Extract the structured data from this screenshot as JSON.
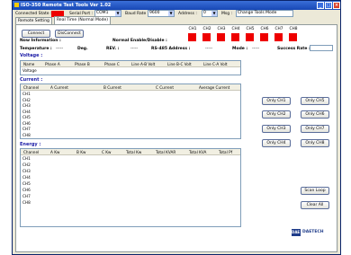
{
  "window": {
    "title": "ISO-350 Remote Test Tools Ver 1.02"
  },
  "connection": {
    "state_label": "Connected State :",
    "serial_label": "Serial Port :",
    "serial_value": "COM1",
    "baud_label": "Baud Rate :",
    "baud_value": "9600",
    "address_label": "Address :",
    "address_value": "0",
    "msg_label": "Msg :",
    "msg_value": "Change Tools Mode",
    "status_color": "#ee0000"
  },
  "tabs": [
    {
      "label": "Remote Setting"
    },
    {
      "label": "Real Time (Normal Mode)"
    }
  ],
  "controls": {
    "connect": "Connect",
    "disconnect": "DisConnect",
    "now_info": "Now Information :",
    "normal_enable": "Normal Enable/Disable :",
    "temperature": "Temperature :",
    "temp_value": "-----",
    "temp_unit": "Deg.",
    "rev_label": "REV. :",
    "rev_value": "-----",
    "rs485_label": "RS-485 Address :",
    "rs485_value": "-----",
    "mode_label": "Mode :",
    "mode_value": "-----",
    "success_label": "Success Rate :"
  },
  "channels": [
    "CH1",
    "CH2",
    "CH3",
    "CH4",
    "CH5",
    "CH6",
    "CH7",
    "CH8"
  ],
  "voltage": {
    "title": "Voltage :",
    "headers": [
      "Name",
      "Phase A",
      "Phase B",
      "Phase C",
      "Line A-B Volt",
      "Line B-C Volt",
      "Line C-A Volt"
    ],
    "row": "Voltage"
  },
  "current": {
    "title": "Current :",
    "headers": [
      "Channel",
      "A Current",
      "B Current",
      "C Current",
      "Average Current"
    ]
  },
  "energy": {
    "title": "Energy :",
    "headers": [
      "Channel",
      "A Kw",
      "B Kw",
      "C Kw",
      "Total Kw",
      "Total KVAR",
      "Total KVA",
      "Total Pf"
    ]
  },
  "only_buttons": [
    "Only CH1",
    "Only CH5",
    "Only CH2",
    "Only CH6",
    "Only CH3",
    "Only CH7",
    "Only CH4",
    "Only CH8"
  ],
  "actions": {
    "scan_loop": "Scan Loop",
    "clear_all": "Clear All"
  },
  "brand": {
    "logo": "DAE",
    "name": "DAETECH"
  }
}
